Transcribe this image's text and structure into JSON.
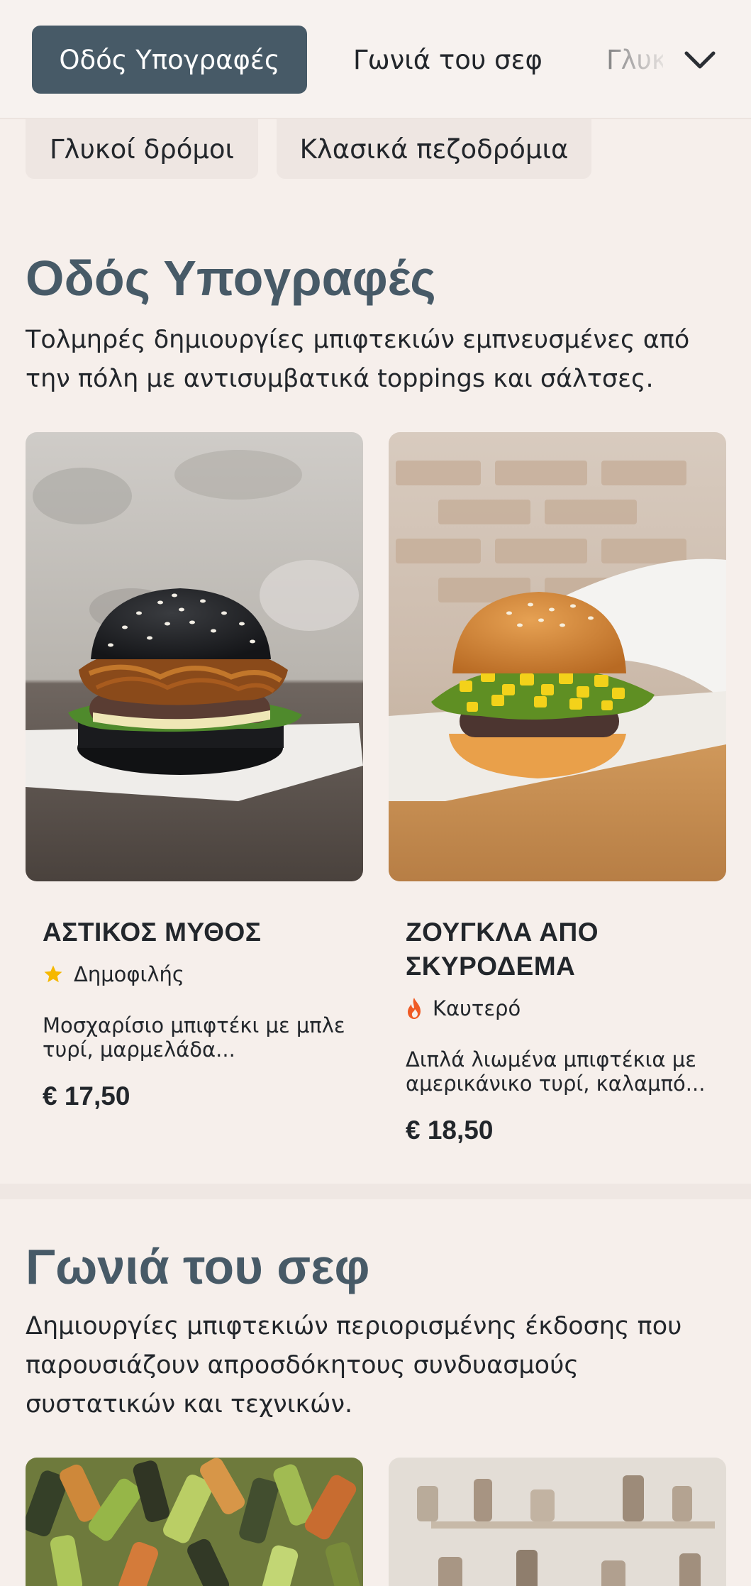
{
  "nav": {
    "tabs": [
      {
        "label": "Οδός Υπογραφές",
        "active": true
      },
      {
        "label": "Γωνιά του σεφ",
        "active": false
      },
      {
        "label": "Γλυκ",
        "active": false
      }
    ],
    "expand_icon": "chevron-down-icon"
  },
  "chips": [
    {
      "label": "Γλυκοί δρόμοι"
    },
    {
      "label": "Κλασικά πεζοδρόμια"
    }
  ],
  "sections": [
    {
      "title": "Οδός Υπογραφές",
      "description": "Τολμηρές δημιουργίες μπιφτεκιών εμπνευσμένες από την πόλη με αντισυμβατικά toppings και σάλτσες.",
      "cards": [
        {
          "name": "ΑΣΤΙΚΟΣ ΜΥΘΟΣ",
          "badge": {
            "icon": "star-icon",
            "label": "Δημοφιλής",
            "color": "#f5b800"
          },
          "description": "Μοσχαρίσιο μπιφτέκι με μπλε τυρί, μαρμελάδα...",
          "price": "€ 17,50"
        },
        {
          "name": "ΖΟΥΓΚΛΑ ΑΠΟ ΣΚΥΡΟΔΕΜΑ",
          "badge": {
            "icon": "flame-icon",
            "label": "Καυτερό",
            "color": "#ef5a24"
          },
          "description": "Διπλά λιωμένα μπιφτέκια με αμερικάνικο τυρί, καλαμπό...",
          "price": "€ 18,50"
        }
      ]
    },
    {
      "title": "Γωνιά του σεφ",
      "description": "Δημιουργίες μπιφτεκιών περιορισμένης έκδοσης που παρουσιάζουν απροσδόκητους συνδυασμούς συστατικών και τεχνικών."
    }
  ],
  "colors": {
    "accent": "#475a67",
    "background": "#f6efeb"
  }
}
